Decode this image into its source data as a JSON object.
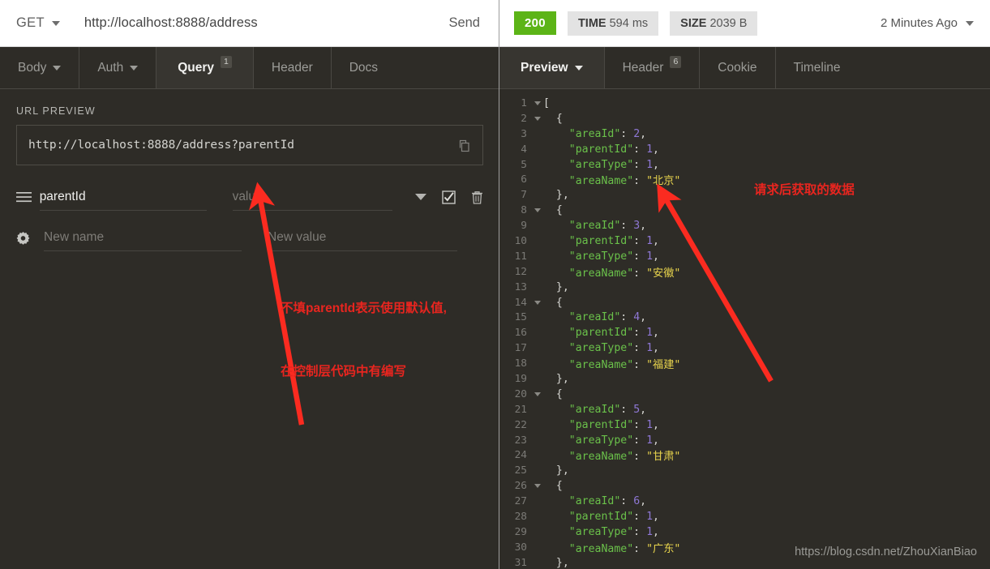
{
  "request": {
    "method": "GET",
    "url": "http://localhost:8888/address",
    "send_label": "Send"
  },
  "request_tabs": [
    {
      "label": "Body",
      "caret": true,
      "badge": "",
      "active": false
    },
    {
      "label": "Auth",
      "caret": true,
      "badge": "",
      "active": false
    },
    {
      "label": "Query",
      "caret": false,
      "badge": "1",
      "active": true
    },
    {
      "label": "Header",
      "caret": false,
      "badge": "",
      "active": false
    },
    {
      "label": "Docs",
      "caret": false,
      "badge": "",
      "active": false
    }
  ],
  "url_preview": {
    "label": "URL PREVIEW",
    "value": "http://localhost:8888/address?parentId",
    "copy_icon": "copy-icon"
  },
  "params": [
    {
      "handle_icon": "drag-handle-icon",
      "name": "parentId",
      "name_is_placeholder": false,
      "value": "value",
      "value_is_placeholder": true,
      "caret_icon": "chevron-down-icon",
      "checkbox_icon": "checkbox-checked-icon",
      "delete_icon": "trash-icon"
    },
    {
      "handle_icon": "gear-icon",
      "name": "New name",
      "name_is_placeholder": true,
      "value": "New value",
      "value_is_placeholder": true,
      "caret_icon": "",
      "checkbox_icon": "",
      "delete_icon": ""
    }
  ],
  "response": {
    "status_code": "200",
    "status_color": "#5cb417",
    "time_label": "TIME",
    "time_value": "594 ms",
    "size_label": "SIZE",
    "size_value": "2039 B",
    "time_ago": "2 Minutes Ago"
  },
  "response_tabs": [
    {
      "label": "Preview",
      "caret": true,
      "badge": "",
      "active": true
    },
    {
      "label": "Header",
      "caret": false,
      "badge": "6",
      "active": false
    },
    {
      "label": "Cookie",
      "caret": false,
      "badge": "",
      "active": false
    },
    {
      "label": "Timeline",
      "caret": false,
      "badge": "",
      "active": false
    }
  ],
  "json_lines": [
    {
      "num": "1",
      "fold": true,
      "indent": 0,
      "parts": [
        {
          "t": "[",
          "c": "p"
        }
      ]
    },
    {
      "num": "2",
      "fold": true,
      "indent": 1,
      "parts": [
        {
          "t": "{",
          "c": "p"
        }
      ]
    },
    {
      "num": "3",
      "fold": false,
      "indent": 2,
      "parts": [
        {
          "t": "\"areaId\"",
          "c": "k"
        },
        {
          "t": ": ",
          "c": "p"
        },
        {
          "t": "2",
          "c": "n"
        },
        {
          "t": ",",
          "c": "p"
        }
      ]
    },
    {
      "num": "4",
      "fold": false,
      "indent": 2,
      "parts": [
        {
          "t": "\"parentId\"",
          "c": "k"
        },
        {
          "t": ": ",
          "c": "p"
        },
        {
          "t": "1",
          "c": "n"
        },
        {
          "t": ",",
          "c": "p"
        }
      ]
    },
    {
      "num": "5",
      "fold": false,
      "indent": 2,
      "parts": [
        {
          "t": "\"areaType\"",
          "c": "k"
        },
        {
          "t": ": ",
          "c": "p"
        },
        {
          "t": "1",
          "c": "n"
        },
        {
          "t": ",",
          "c": "p"
        }
      ]
    },
    {
      "num": "6",
      "fold": false,
      "indent": 2,
      "parts": [
        {
          "t": "\"areaName\"",
          "c": "k"
        },
        {
          "t": ": ",
          "c": "p"
        },
        {
          "t": "\"北京\"",
          "c": "s"
        }
      ]
    },
    {
      "num": "7",
      "fold": false,
      "indent": 1,
      "parts": [
        {
          "t": "},",
          "c": "p"
        }
      ]
    },
    {
      "num": "8",
      "fold": true,
      "indent": 1,
      "parts": [
        {
          "t": "{",
          "c": "p"
        }
      ]
    },
    {
      "num": "9",
      "fold": false,
      "indent": 2,
      "parts": [
        {
          "t": "\"areaId\"",
          "c": "k"
        },
        {
          "t": ": ",
          "c": "p"
        },
        {
          "t": "3",
          "c": "n"
        },
        {
          "t": ",",
          "c": "p"
        }
      ]
    },
    {
      "num": "10",
      "fold": false,
      "indent": 2,
      "parts": [
        {
          "t": "\"parentId\"",
          "c": "k"
        },
        {
          "t": ": ",
          "c": "p"
        },
        {
          "t": "1",
          "c": "n"
        },
        {
          "t": ",",
          "c": "p"
        }
      ]
    },
    {
      "num": "11",
      "fold": false,
      "indent": 2,
      "parts": [
        {
          "t": "\"areaType\"",
          "c": "k"
        },
        {
          "t": ": ",
          "c": "p"
        },
        {
          "t": "1",
          "c": "n"
        },
        {
          "t": ",",
          "c": "p"
        }
      ]
    },
    {
      "num": "12",
      "fold": false,
      "indent": 2,
      "parts": [
        {
          "t": "\"areaName\"",
          "c": "k"
        },
        {
          "t": ": ",
          "c": "p"
        },
        {
          "t": "\"安徽\"",
          "c": "s"
        }
      ]
    },
    {
      "num": "13",
      "fold": false,
      "indent": 1,
      "parts": [
        {
          "t": "},",
          "c": "p"
        }
      ]
    },
    {
      "num": "14",
      "fold": true,
      "indent": 1,
      "parts": [
        {
          "t": "{",
          "c": "p"
        }
      ]
    },
    {
      "num": "15",
      "fold": false,
      "indent": 2,
      "parts": [
        {
          "t": "\"areaId\"",
          "c": "k"
        },
        {
          "t": ": ",
          "c": "p"
        },
        {
          "t": "4",
          "c": "n"
        },
        {
          "t": ",",
          "c": "p"
        }
      ]
    },
    {
      "num": "16",
      "fold": false,
      "indent": 2,
      "parts": [
        {
          "t": "\"parentId\"",
          "c": "k"
        },
        {
          "t": ": ",
          "c": "p"
        },
        {
          "t": "1",
          "c": "n"
        },
        {
          "t": ",",
          "c": "p"
        }
      ]
    },
    {
      "num": "17",
      "fold": false,
      "indent": 2,
      "parts": [
        {
          "t": "\"areaType\"",
          "c": "k"
        },
        {
          "t": ": ",
          "c": "p"
        },
        {
          "t": "1",
          "c": "n"
        },
        {
          "t": ",",
          "c": "p"
        }
      ]
    },
    {
      "num": "18",
      "fold": false,
      "indent": 2,
      "parts": [
        {
          "t": "\"areaName\"",
          "c": "k"
        },
        {
          "t": ": ",
          "c": "p"
        },
        {
          "t": "\"福建\"",
          "c": "s"
        }
      ]
    },
    {
      "num": "19",
      "fold": false,
      "indent": 1,
      "parts": [
        {
          "t": "},",
          "c": "p"
        }
      ]
    },
    {
      "num": "20",
      "fold": true,
      "indent": 1,
      "parts": [
        {
          "t": "{",
          "c": "p"
        }
      ]
    },
    {
      "num": "21",
      "fold": false,
      "indent": 2,
      "parts": [
        {
          "t": "\"areaId\"",
          "c": "k"
        },
        {
          "t": ": ",
          "c": "p"
        },
        {
          "t": "5",
          "c": "n"
        },
        {
          "t": ",",
          "c": "p"
        }
      ]
    },
    {
      "num": "22",
      "fold": false,
      "indent": 2,
      "parts": [
        {
          "t": "\"parentId\"",
          "c": "k"
        },
        {
          "t": ": ",
          "c": "p"
        },
        {
          "t": "1",
          "c": "n"
        },
        {
          "t": ",",
          "c": "p"
        }
      ]
    },
    {
      "num": "23",
      "fold": false,
      "indent": 2,
      "parts": [
        {
          "t": "\"areaType\"",
          "c": "k"
        },
        {
          "t": ": ",
          "c": "p"
        },
        {
          "t": "1",
          "c": "n"
        },
        {
          "t": ",",
          "c": "p"
        }
      ]
    },
    {
      "num": "24",
      "fold": false,
      "indent": 2,
      "parts": [
        {
          "t": "\"areaName\"",
          "c": "k"
        },
        {
          "t": ": ",
          "c": "p"
        },
        {
          "t": "\"甘肃\"",
          "c": "s"
        }
      ]
    },
    {
      "num": "25",
      "fold": false,
      "indent": 1,
      "parts": [
        {
          "t": "},",
          "c": "p"
        }
      ]
    },
    {
      "num": "26",
      "fold": true,
      "indent": 1,
      "parts": [
        {
          "t": "{",
          "c": "p"
        }
      ]
    },
    {
      "num": "27",
      "fold": false,
      "indent": 2,
      "parts": [
        {
          "t": "\"areaId\"",
          "c": "k"
        },
        {
          "t": ": ",
          "c": "p"
        },
        {
          "t": "6",
          "c": "n"
        },
        {
          "t": ",",
          "c": "p"
        }
      ]
    },
    {
      "num": "28",
      "fold": false,
      "indent": 2,
      "parts": [
        {
          "t": "\"parentId\"",
          "c": "k"
        },
        {
          "t": ": ",
          "c": "p"
        },
        {
          "t": "1",
          "c": "n"
        },
        {
          "t": ",",
          "c": "p"
        }
      ]
    },
    {
      "num": "29",
      "fold": false,
      "indent": 2,
      "parts": [
        {
          "t": "\"areaType\"",
          "c": "k"
        },
        {
          "t": ": ",
          "c": "p"
        },
        {
          "t": "1",
          "c": "n"
        },
        {
          "t": ",",
          "c": "p"
        }
      ]
    },
    {
      "num": "30",
      "fold": false,
      "indent": 2,
      "parts": [
        {
          "t": "\"areaName\"",
          "c": "k"
        },
        {
          "t": ": ",
          "c": "p"
        },
        {
          "t": "\"广东\"",
          "c": "s"
        }
      ]
    },
    {
      "num": "31",
      "fold": false,
      "indent": 1,
      "parts": [
        {
          "t": "},",
          "c": "p"
        }
      ]
    }
  ],
  "annotations": {
    "left_line1": "不填parentId表示使用默认值,",
    "left_line2": "在控制层代码中有编写",
    "right_text": "请求后获取的数据",
    "color": "#e8251f"
  },
  "watermark": "https://blog.csdn.net/ZhouXianBiao"
}
